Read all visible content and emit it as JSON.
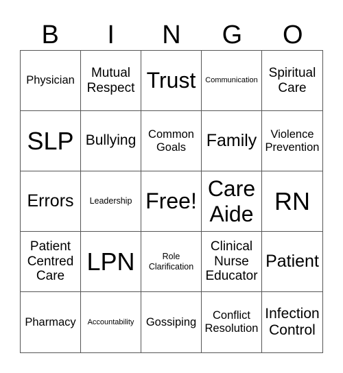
{
  "header": [
    "B",
    "I",
    "N",
    "G",
    "O"
  ],
  "cells": [
    {
      "text": "Physician",
      "size": "s-m"
    },
    {
      "text": "Mutual Respect",
      "size": "s-ml"
    },
    {
      "text": "Trust",
      "size": "s-xxl"
    },
    {
      "text": "Communication",
      "size": "s-xs"
    },
    {
      "text": "Spiritual Care",
      "size": "s-ml"
    },
    {
      "text": "SLP",
      "size": "s-xxxl"
    },
    {
      "text": "Bullying",
      "size": "s-l"
    },
    {
      "text": "Common Goals",
      "size": "s-m"
    },
    {
      "text": "Family",
      "size": "s-xl"
    },
    {
      "text": "Violence Prevention",
      "size": "s-m"
    },
    {
      "text": "Errors",
      "size": "s-xl"
    },
    {
      "text": "Leadership",
      "size": "s-s"
    },
    {
      "text": "Free!",
      "size": "s-xxl"
    },
    {
      "text": "Care Aide",
      "size": "s-xxl"
    },
    {
      "text": "RN",
      "size": "s-xxxl"
    },
    {
      "text": "Patient Centred Care",
      "size": "s-ml"
    },
    {
      "text": "LPN",
      "size": "s-xxxl"
    },
    {
      "text": "Role Clarification",
      "size": "s-s"
    },
    {
      "text": "Clinical Nurse Educator",
      "size": "s-ml"
    },
    {
      "text": "Patient",
      "size": "s-xl"
    },
    {
      "text": "Pharmacy",
      "size": "s-m"
    },
    {
      "text": "Accountability",
      "size": "s-xs"
    },
    {
      "text": "Gossiping",
      "size": "s-m"
    },
    {
      "text": "Conflict Resolution",
      "size": "s-m"
    },
    {
      "text": "Infection Control",
      "size": "s-l"
    }
  ]
}
